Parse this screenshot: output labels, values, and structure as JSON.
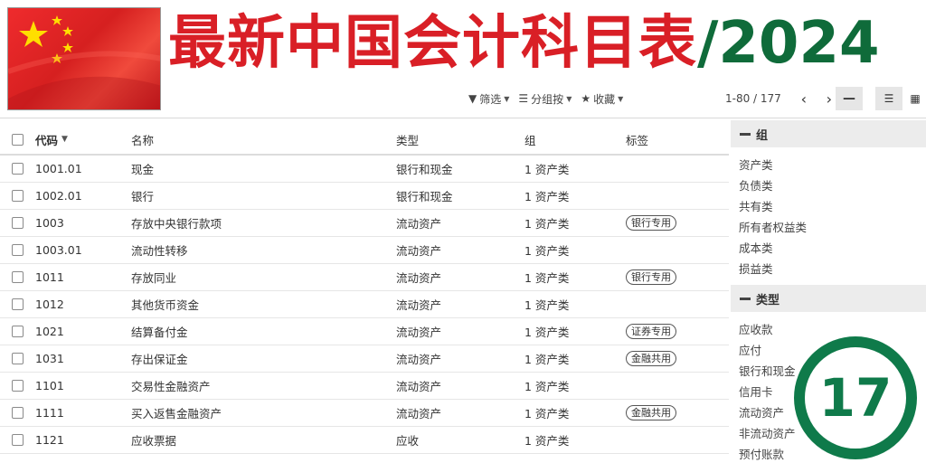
{
  "banner": {
    "title_cn": "最新中国会计科目表",
    "title_year": "/2024",
    "colors": {
      "red": "#d91f26",
      "green": "#0f6b3a"
    }
  },
  "toolbar": {
    "filter_label": "筛选",
    "group_label": "分组按",
    "favorites_label": "收藏",
    "pager_text": "1-80 / 177",
    "prev_icon": "chevron-left-icon",
    "next_icon": "chevron-right-icon"
  },
  "table": {
    "columns": {
      "code": "代码",
      "name": "名称",
      "type": "类型",
      "group": "组",
      "tags": "标签"
    },
    "rows": [
      {
        "code": "1001.01",
        "name": "现金",
        "type": "银行和现金",
        "group": "1 资产类",
        "tag": ""
      },
      {
        "code": "1002.01",
        "name": "银行",
        "type": "银行和现金",
        "group": "1 资产类",
        "tag": ""
      },
      {
        "code": "1003",
        "name": "存放中央银行款项",
        "type": "流动资产",
        "group": "1 资产类",
        "tag": "银行专用"
      },
      {
        "code": "1003.01",
        "name": "流动性转移",
        "type": "流动资产",
        "group": "1 资产类",
        "tag": ""
      },
      {
        "code": "1011",
        "name": "存放同业",
        "type": "流动资产",
        "group": "1 资产类",
        "tag": "银行专用"
      },
      {
        "code": "1012",
        "name": "其他货币资金",
        "type": "流动资产",
        "group": "1 资产类",
        "tag": ""
      },
      {
        "code": "1021",
        "name": "结算备付金",
        "type": "流动资产",
        "group": "1 资产类",
        "tag": "证券专用"
      },
      {
        "code": "1031",
        "name": "存出保证金",
        "type": "流动资产",
        "group": "1 资产类",
        "tag": "金融共用"
      },
      {
        "code": "1101",
        "name": "交易性金融资产",
        "type": "流动资产",
        "group": "1 资产类",
        "tag": ""
      },
      {
        "code": "1111",
        "name": "买入返售金融资产",
        "type": "流动资产",
        "group": "1 资产类",
        "tag": "金融共用"
      },
      {
        "code": "1121",
        "name": "应收票据",
        "type": "应收",
        "group": "1 资产类",
        "tag": ""
      }
    ]
  },
  "sidebar": {
    "group_title": "组",
    "groups": [
      "资产类",
      "负债类",
      "共有类",
      "所有者权益类",
      "成本类",
      "损益类"
    ],
    "type_title": "类型",
    "types": [
      "应收款",
      "应付",
      "银行和现金",
      "信用卡",
      "流动资产",
      "非流动资产",
      "预付账款"
    ]
  },
  "version_badge": {
    "text": "17",
    "color": "#0f7a4a"
  }
}
